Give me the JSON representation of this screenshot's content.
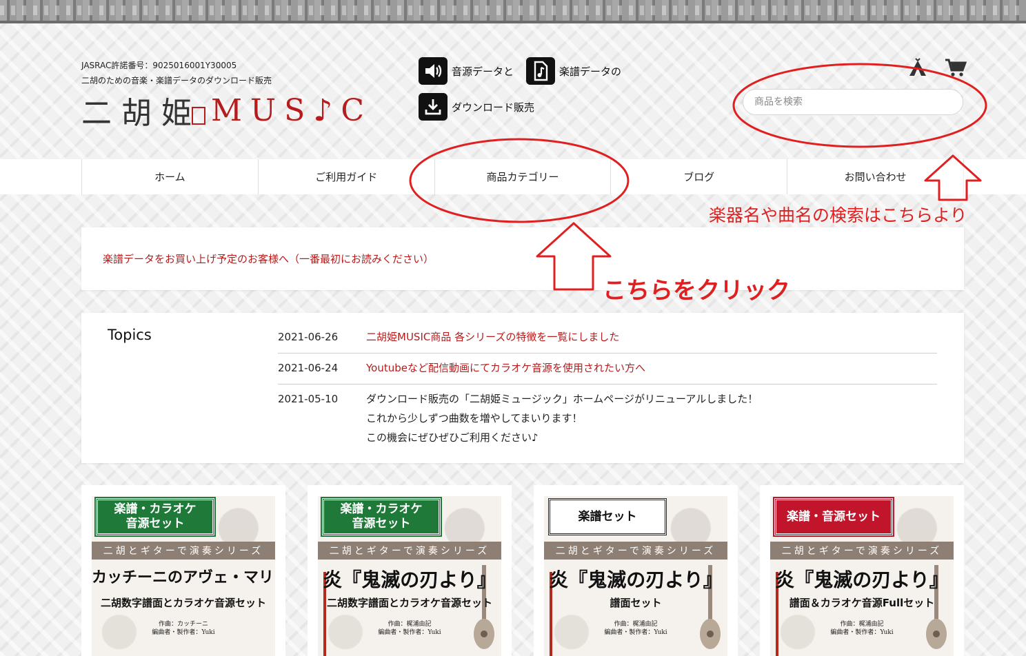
{
  "header": {
    "jasrac": "JASRAC許諾番号：9025016001Y30005",
    "tagline": "二胡のための音楽・楽譜データのダウンロード販売",
    "logo_kanji": "二胡姫",
    "logo_music": "MUS♪C",
    "features": [
      {
        "icon": "speaker-icon",
        "label": "音源データと"
      },
      {
        "icon": "music-note-file-icon",
        "label": "楽譜データの"
      },
      {
        "icon": "download-icon",
        "label": "ダウンロード販売"
      }
    ],
    "search_placeholder": "商品を検索"
  },
  "nav": {
    "items": [
      "ホーム",
      "ご利用ガイド",
      "商品カテゴリー",
      "ブログ",
      "お問い合わせ"
    ]
  },
  "notice": {
    "link_text": "楽譜データをお買い上げ予定のお客様へ（一番最初にお読みください）"
  },
  "topics": {
    "title": "Topics",
    "items": [
      {
        "date": "2021-06-26",
        "lines": [
          "二胡姫MUSIC商品 各シリーズの特徴を一覧にしました"
        ],
        "link": true
      },
      {
        "date": "2021-06-24",
        "lines": [
          "Youtubeなど配信動画にてカラオケ音源を使用されたい方へ"
        ],
        "link": true
      },
      {
        "date": "2021-05-10",
        "lines": [
          "ダウンロード販売の「二胡姫ミュージック」ホームページがリニューアルしました！",
          "これから少しずつ曲数を増やしてまいります！",
          "この機会にぜひぜひご利用ください♪"
        ],
        "link": false
      }
    ]
  },
  "products": [
    {
      "badge": [
        "楽譜・カラオケ",
        "音源セット"
      ],
      "badge_style": "green",
      "series": "二胡とギターで演奏シリーズ",
      "title": "カッチーニのアヴェ・マリア",
      "subtitle": "二胡数字譜面とカラオケ音源セット",
      "credits": [
        "作曲：カッチーニ",
        "編曲者・製作者：Yuki"
      ]
    },
    {
      "badge": [
        "楽譜・カラオケ",
        "音源セット"
      ],
      "badge_style": "green",
      "series": "二胡とギターで演奏シリーズ",
      "title": "炎『鬼滅の刃より』",
      "subtitle": "二胡数字譜面とカラオケ音源セット",
      "credits": [
        "作曲：梶浦由記",
        "編曲者・製作者：Yuki"
      ]
    },
    {
      "badge": [
        "楽譜セット"
      ],
      "badge_style": "white",
      "series": "二胡とギターで演奏シリーズ",
      "title": "炎『鬼滅の刃より』",
      "subtitle": "譜面セット",
      "credits": [
        "作曲：梶浦由記",
        "編曲者・製作者：Yuki"
      ]
    },
    {
      "badge": [
        "楽譜・音源セット"
      ],
      "badge_style": "red",
      "series": "二胡とギターで演奏シリーズ",
      "title": "炎『鬼滅の刃より』",
      "subtitle": "譜面＆カラオケ音源Fullセット",
      "credits": [
        "作曲：梶浦由記",
        "編曲者・製作者：Yuki"
      ]
    }
  ],
  "annotations": {
    "search_hint": "楽器名や曲名の検索はこちらより",
    "click_hint": "こちらをクリック",
    "color": "#e02020"
  },
  "colors": {
    "accent_red": "#b71c1c",
    "badge_green": "#1f7a3a",
    "badge_red": "#c0152b"
  }
}
